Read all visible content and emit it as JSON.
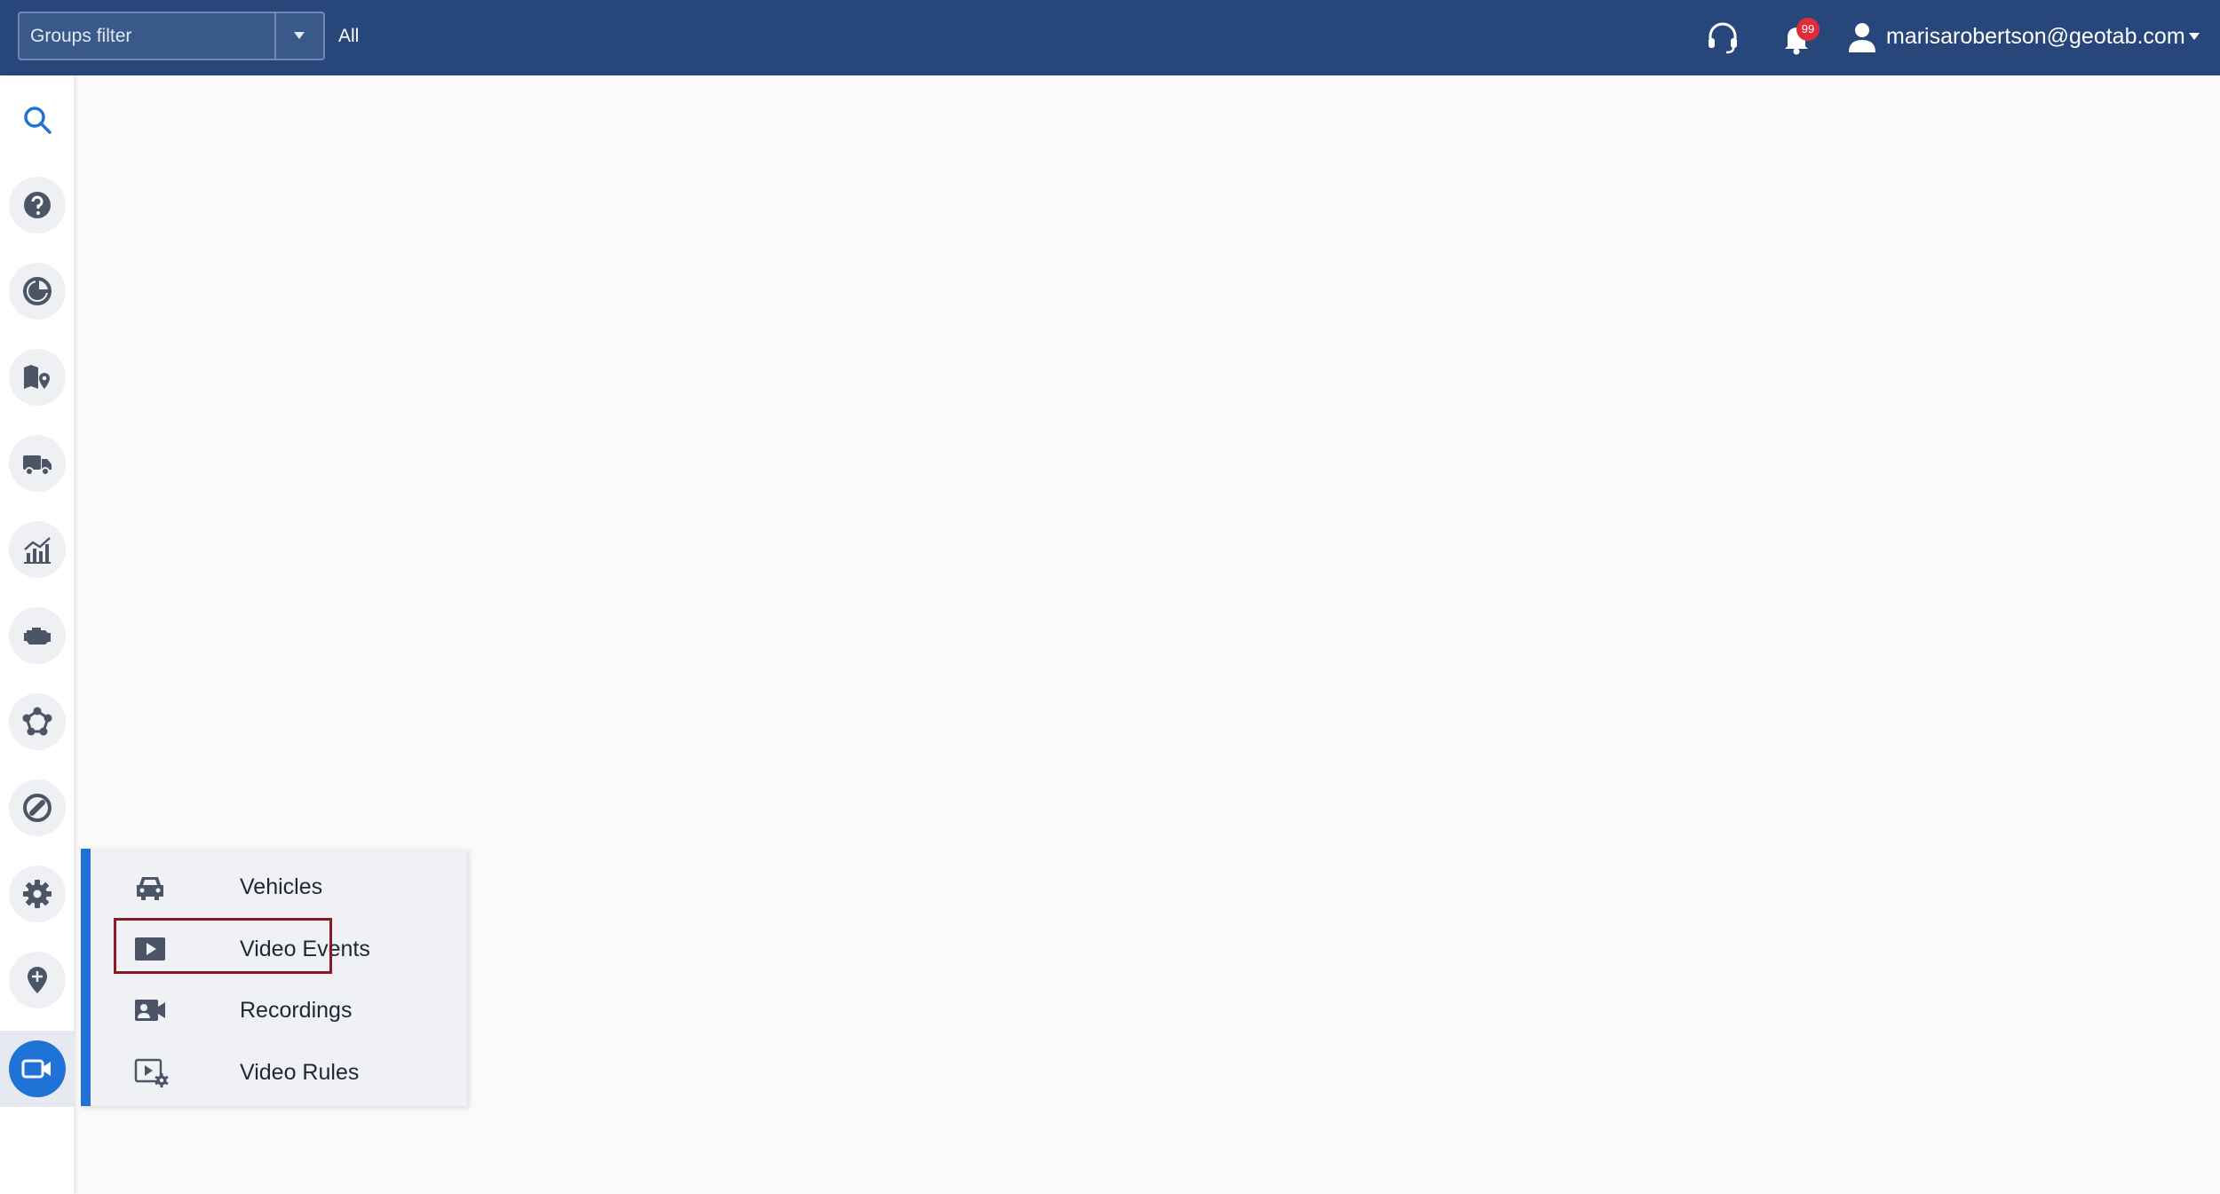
{
  "header": {
    "groups_filter_placeholder": "Groups filter",
    "groups_value": "All",
    "notification_count": "99",
    "user_email": "marisarobertson@geotab.com"
  },
  "sidebar": {
    "items": [
      {
        "name": "search",
        "icon": "search-icon"
      },
      {
        "name": "help",
        "icon": "help-icon"
      },
      {
        "name": "productivity",
        "icon": "pie-chart-icon"
      },
      {
        "name": "map",
        "icon": "map-pin-icon"
      },
      {
        "name": "vehicles",
        "icon": "truck-icon"
      },
      {
        "name": "reports",
        "icon": "chart-icon"
      },
      {
        "name": "engine",
        "icon": "engine-icon"
      },
      {
        "name": "rules",
        "icon": "nodes-icon"
      },
      {
        "name": "compliance",
        "icon": "no-entry-icon"
      },
      {
        "name": "settings",
        "icon": "gear-icon"
      },
      {
        "name": "marketplace",
        "icon": "location-plus-icon"
      },
      {
        "name": "video",
        "icon": "video-camera-icon",
        "active": true
      }
    ]
  },
  "flyout": {
    "items": [
      {
        "label": "Vehicles",
        "icon": "car-icon"
      },
      {
        "label": "Video Events",
        "icon": "play-icon",
        "highlighted": true
      },
      {
        "label": "Recordings",
        "icon": "recording-icon"
      },
      {
        "label": "Video Rules",
        "icon": "video-rules-icon"
      }
    ]
  },
  "colors": {
    "topbar": "#27477b",
    "accent": "#1f73d6",
    "highlight": "#8b1a24",
    "badge": "#e02b3a"
  }
}
